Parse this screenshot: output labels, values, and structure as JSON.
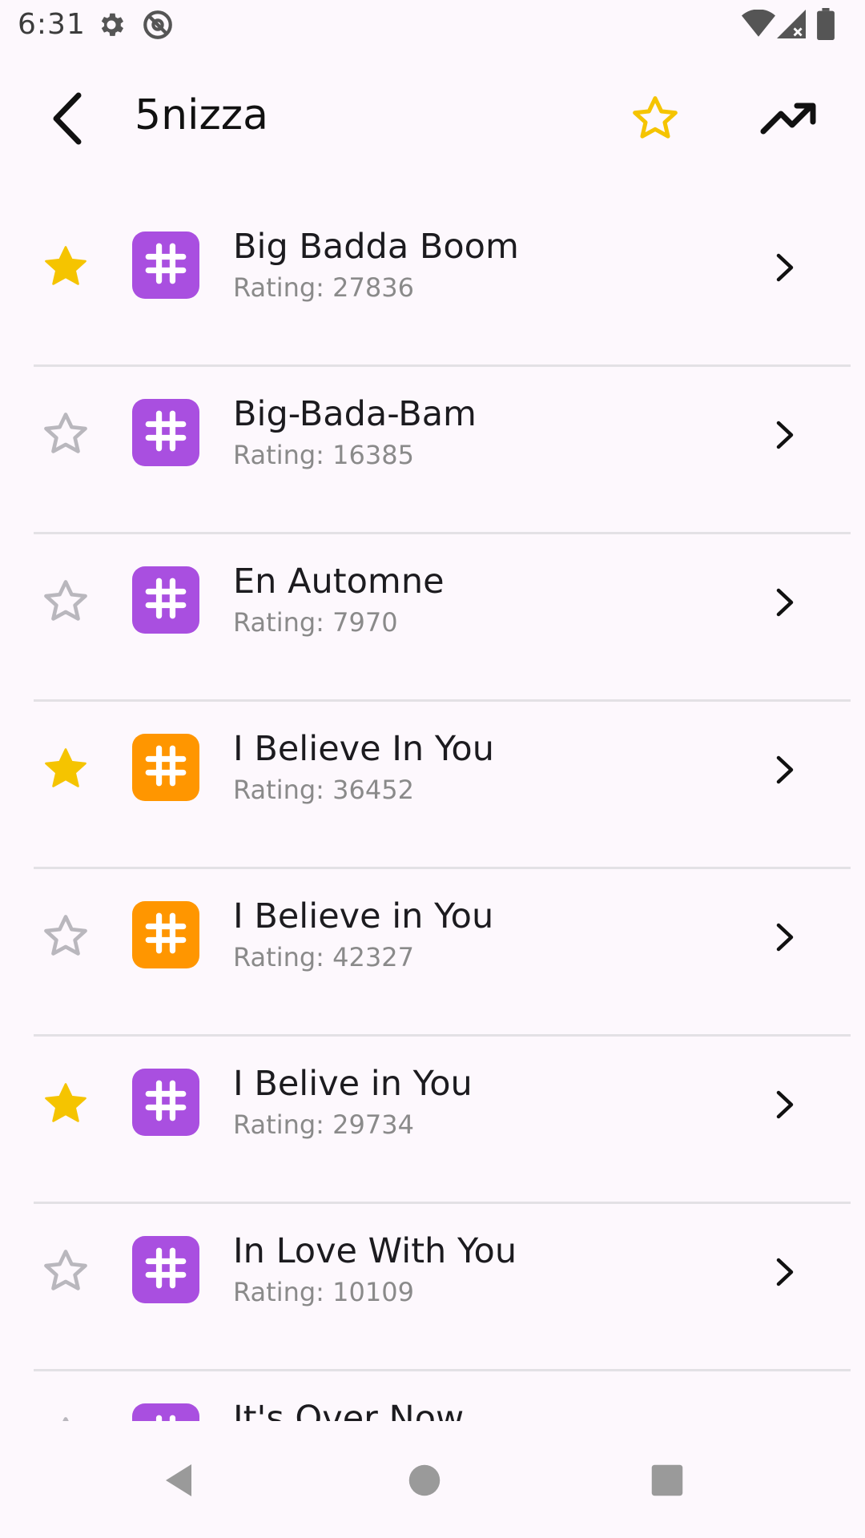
{
  "status_bar": {
    "time": "6:31",
    "icons": [
      "gear-icon",
      "at-sign-icon",
      "wifi-icon",
      "cell-signal-icon",
      "battery-icon"
    ]
  },
  "app_bar": {
    "back_icon": "arrow-left-icon",
    "title": "5nizza",
    "favorite_icon": "star-outline-icon",
    "trend_icon": "trending-up-icon",
    "accent_color": "#f5c400"
  },
  "songs": [
    {
      "title": "Big Badda Boom",
      "rating": "Rating: 27836",
      "favorite": true,
      "tile_color": "#a94fe0"
    },
    {
      "title": "Big-Bada-Bam",
      "rating": "Rating: 16385",
      "favorite": false,
      "tile_color": "#a94fe0"
    },
    {
      "title": "En Automne",
      "rating": "Rating: 7970",
      "favorite": false,
      "tile_color": "#a94fe0"
    },
    {
      "title": "I Believe In You",
      "rating": "Rating: 36452",
      "favorite": true,
      "tile_color": "#ff9600"
    },
    {
      "title": "I Believe in You",
      "rating": "Rating: 42327",
      "favorite": false,
      "tile_color": "#ff9600"
    },
    {
      "title": "I Belive in You",
      "rating": "Rating: 29734",
      "favorite": true,
      "tile_color": "#a94fe0"
    },
    {
      "title": "In Love With You",
      "rating": "Rating: 10109",
      "favorite": false,
      "tile_color": "#a94fe0"
    },
    {
      "title": "It's Over Now",
      "rating": "",
      "favorite": false,
      "tile_color": "#a94fe0"
    }
  ],
  "colors": {
    "star_filled": "#f5c400",
    "star_empty": "#b9b7bd",
    "purple_tile": "#a94fe0",
    "orange_tile": "#ff9600"
  },
  "nav_bar": {
    "icons": [
      "back-triangle-icon",
      "home-circle-icon",
      "recents-square-icon"
    ]
  }
}
